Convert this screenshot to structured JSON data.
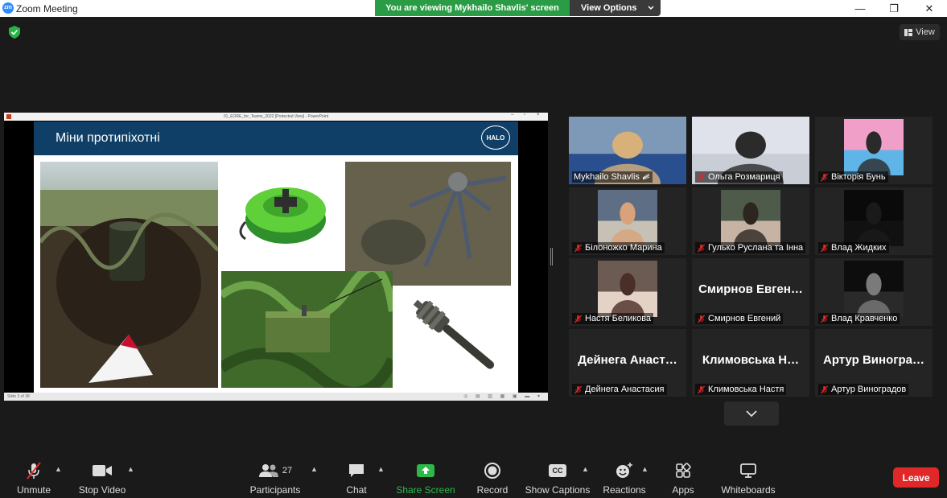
{
  "window": {
    "app_icon": "zm",
    "title": "Zoom Meeting",
    "minimize": "—",
    "maximize": "❐",
    "close": "✕"
  },
  "banner": {
    "viewing_text": "You are viewing Mykhailo Shavlis' screen",
    "view_options": "View Options"
  },
  "top_right": {
    "view_label": "View"
  },
  "shared_screen": {
    "window_title": "01_EORE_for_Teams_2022 [Protected View] - PowerPoint",
    "slide_title": "Міни протипіхотні",
    "logo_text": "HALO",
    "status_text": "Slide 3 of 38"
  },
  "participants": [
    {
      "name": "Mykhailo Shavlis",
      "muted": false,
      "video": true,
      "active": true
    },
    {
      "name": "Ольга Розмариця",
      "muted": true,
      "video": true
    },
    {
      "name": "Вікторія Бунь",
      "muted": true,
      "video": true
    },
    {
      "name": "Білоножко Марина",
      "muted": true,
      "video": true
    },
    {
      "name": "Гулько Руслана та Інна",
      "muted": true,
      "video": true
    },
    {
      "name": "Влад Жидких",
      "muted": true,
      "video": true
    },
    {
      "name": "Настя Беликова",
      "muted": true,
      "video": true
    },
    {
      "name": "Смирнов Евгений",
      "display": "Смирнов  Евген…",
      "muted": true,
      "video": false
    },
    {
      "name": "Влад Кравченко",
      "muted": true,
      "video": true
    },
    {
      "name": "Дейнега Анастасия",
      "display": "Дейнега  Анаст…",
      "muted": true,
      "video": false
    },
    {
      "name": "Климовська Настя",
      "display": "Климовська  Н…",
      "muted": true,
      "video": false
    },
    {
      "name": "Артур Виноградов",
      "display": "Артур  Виногра…",
      "muted": true,
      "video": false
    }
  ],
  "toolbar": {
    "unmute": "Unmute",
    "stop_video": "Stop Video",
    "participants": "Participants",
    "participants_count": "27",
    "chat": "Chat",
    "share_screen": "Share Screen",
    "record": "Record",
    "show_captions": "Show Captions",
    "captions_icon_text": "CC",
    "reactions": "Reactions",
    "apps": "Apps",
    "whiteboards": "Whiteboards",
    "leave": "Leave"
  },
  "colors": {
    "banner_green": "#2a9c45",
    "active_speaker": "#f4e04d",
    "leave_red": "#e02828",
    "share_green": "#2eb84a",
    "mute_red": "#e02828"
  }
}
